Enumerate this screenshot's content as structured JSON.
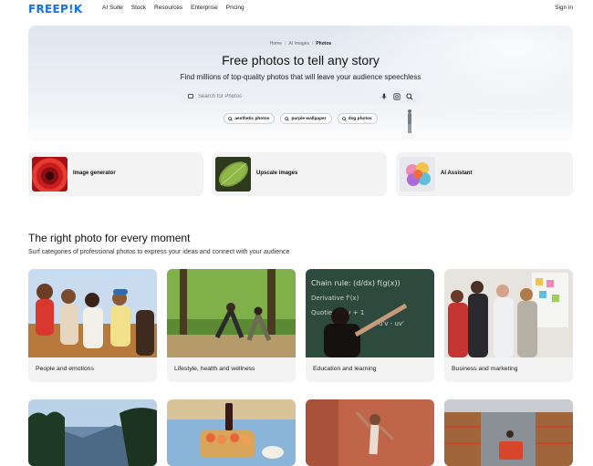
{
  "nav": {
    "logo": "FREEP!K",
    "links": [
      "AI Suite",
      "Stock",
      "Resources",
      "Enterprise",
      "Pricing"
    ],
    "signin": "Sign in"
  },
  "hero": {
    "breadcrumb": [
      "Home",
      "AI Images",
      "Photos"
    ],
    "title": "Free photos to tell any story",
    "subtitle": "Find millions of top-quality photos that will leave your audience speechless",
    "search_placeholder": "Search for Photos",
    "chips": [
      "aesthetic photos",
      "purple wallpaper",
      "dog photos"
    ]
  },
  "tools": [
    {
      "label": "Image generator"
    },
    {
      "label": "Upscale images"
    },
    {
      "label": "AI Assistant"
    }
  ],
  "section": {
    "title": "The right photo for every moment",
    "subtitle": "Surf categories of professional photos to express your ideas and connect with your audience",
    "categories": [
      "People and emotions",
      "Lifestyle, health and wellness",
      "Education and learning",
      "Business and marketing"
    ]
  },
  "colors": {
    "brand": "#1273eb",
    "card_bg": "#f3f3f4"
  }
}
